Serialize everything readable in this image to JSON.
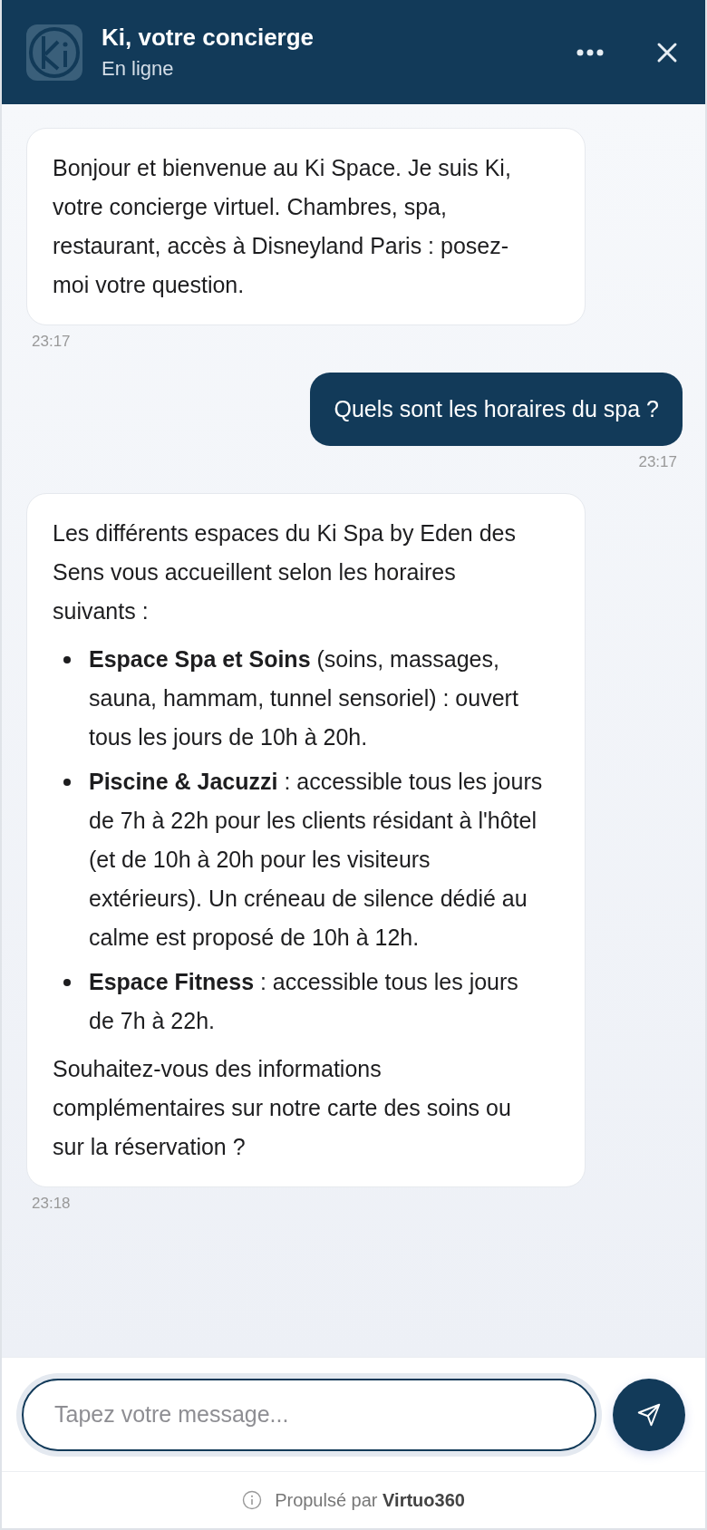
{
  "header": {
    "title": "Ki, votre concierge",
    "status": "En ligne"
  },
  "messages": [
    {
      "kind": "bot",
      "time": "23:17",
      "blocks": [
        {
          "kind": "paragraph",
          "text": "Bonjour et bienvenue au Ki Space. Je suis Ki, votre concierge virtuel. Chambres, spa, restaurant, accès à Disneyland Paris : posez-moi votre question."
        }
      ]
    },
    {
      "kind": "user",
      "time": "23:17",
      "blocks": [
        {
          "kind": "paragraph",
          "text": "Quels sont les horaires du spa ?"
        }
      ]
    },
    {
      "kind": "bot",
      "time": "23:18",
      "blocks": [
        {
          "kind": "paragraph",
          "text": "Les différents espaces du Ki Spa by Eden des Sens vous accueillent selon les horaires suivants :"
        },
        {
          "kind": "list",
          "items": [
            "**Espace Spa et Soins** (soins, massages, sauna, hammam, tunnel sensoriel) : ouvert tous les jours de 10h à 20h.",
            "**Piscine & Jacuzzi** : accessible tous les jours de 7h à 22h pour les clients résidant à l'hôtel (et de 10h à 20h pour les visiteurs extérieurs). Un créneau de silence dédié au calme est proposé de 10h à 12h.",
            "**Espace Fitness** : accessible tous les jours de 7h à 22h."
          ]
        },
        {
          "kind": "paragraph",
          "text": "Souhaitez-vous des informations complémentaires sur notre carte des soins ou sur la réservation ?"
        }
      ]
    }
  ],
  "composer": {
    "placeholder": "Tapez votre message..."
  },
  "footer": {
    "text": "Propulsé par **Virtuo360**"
  }
}
